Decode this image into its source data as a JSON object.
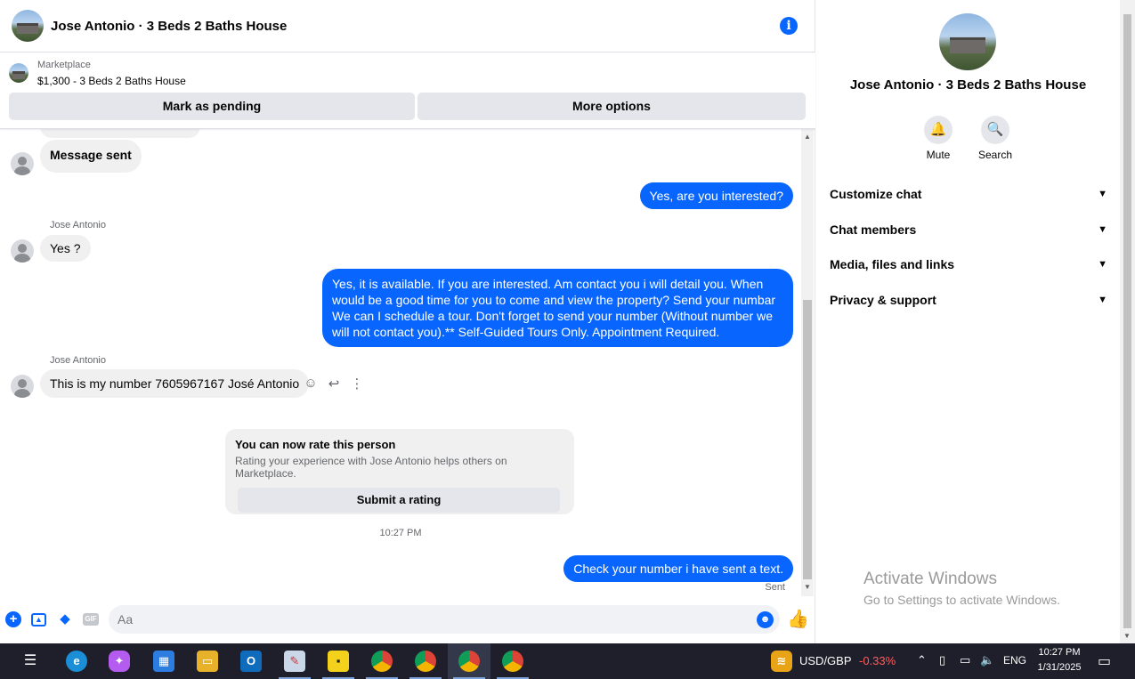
{
  "header": {
    "title": "Jose Antonio · 3 Beds 2 Baths House"
  },
  "marketplace": {
    "label": "Marketplace",
    "listing": "$1,300 - 3 Beds 2 Baths House",
    "pending_button": "Mark as pending",
    "more_button": "More options"
  },
  "messages": {
    "m1": "Message sent",
    "m2": "Yes, are you interested?",
    "sender1": "Jose Antonio",
    "m3": "Yes ?",
    "m4": "Yes, it is available. If you are interested.  Am contact you i will detail you.  When would be a good time for you to come and view the property? Send your numbar We can I schedule a tour.  Don't forget to send your number (Without number we will not contact you).** Self-Guided Tours Only. Appointment Required.",
    "sender2": "Jose Antonio",
    "m5": "This is my number 7605967167 José Antonio",
    "rate_title": "You can now rate this person",
    "rate_sub": "Rating your experience with Jose Antonio helps others on Marketplace.",
    "rate_button": "Submit a rating",
    "timestamp": "10:27 PM",
    "m6": "Check your number i have sent a text.",
    "status": "Sent"
  },
  "composer": {
    "placeholder": "Aa"
  },
  "info_panel": {
    "name": "Jose Antonio · 3 Beds 2 Baths House",
    "mute": "Mute",
    "search": "Search",
    "sections": [
      "Customize chat",
      "Chat members",
      "Media, files and links",
      "Privacy & support"
    ]
  },
  "watermark": {
    "line1": "Activate Windows",
    "line2": "Go to Settings to activate Windows."
  },
  "taskbar": {
    "ticker": "USD/GBP",
    "change": "-0.33%",
    "lang": "ENG",
    "time": "10:27 PM",
    "date": "1/31/2025"
  },
  "colors": {
    "accent": "#0866ff",
    "negative": "#ff5c5c"
  }
}
